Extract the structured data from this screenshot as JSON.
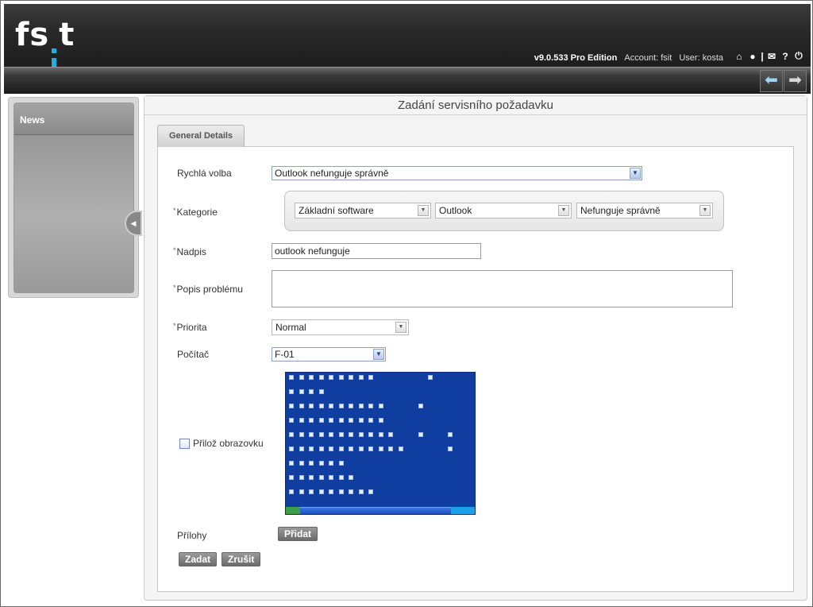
{
  "app": {
    "logo": "fsit",
    "version": "v9.0.533 Pro Edition",
    "account": "Account: fsit",
    "user": "User: kosta",
    "icons": [
      "home-icon",
      "user-icon",
      "separator",
      "mail-icon",
      "help-icon",
      "power-icon"
    ],
    "help_glyph": "?"
  },
  "nav": {
    "back_icon": "arrow-left-icon",
    "forward_icon": "arrow-right-icon"
  },
  "sidebar": {
    "title": "News"
  },
  "page": {
    "title": "Zadání servisního požadavku",
    "tab": "General Details"
  },
  "form": {
    "quick_choice": {
      "label": "Rychlá volba",
      "value": "Outlook nefunguje správně"
    },
    "category": {
      "label": "Kategorie",
      "required_mark": "*",
      "levels": [
        "Základní software",
        "Outlook",
        "Nefunguje správně"
      ]
    },
    "title": {
      "label": "Nadpis",
      "required_mark": "*",
      "value": "outlook nefunguje"
    },
    "description": {
      "label": "Popis problému",
      "required_mark": "*",
      "value": ""
    },
    "priority": {
      "label": "Priorita",
      "required_mark": "*",
      "value": "Normal"
    },
    "computer": {
      "label": "Počítač",
      "value": "F-01"
    },
    "attach_screen": {
      "label": "Přilož obrazovku",
      "checked": false
    },
    "attachments": {
      "label": "Přílohy",
      "add_button": "Přidat"
    }
  },
  "actions": {
    "submit": "Zadat",
    "cancel": "Zrušit"
  },
  "colors": {
    "accent": "#1fb0dc",
    "header_bg": "#2a2a2a",
    "desktop_bg": "#0f3da0"
  }
}
